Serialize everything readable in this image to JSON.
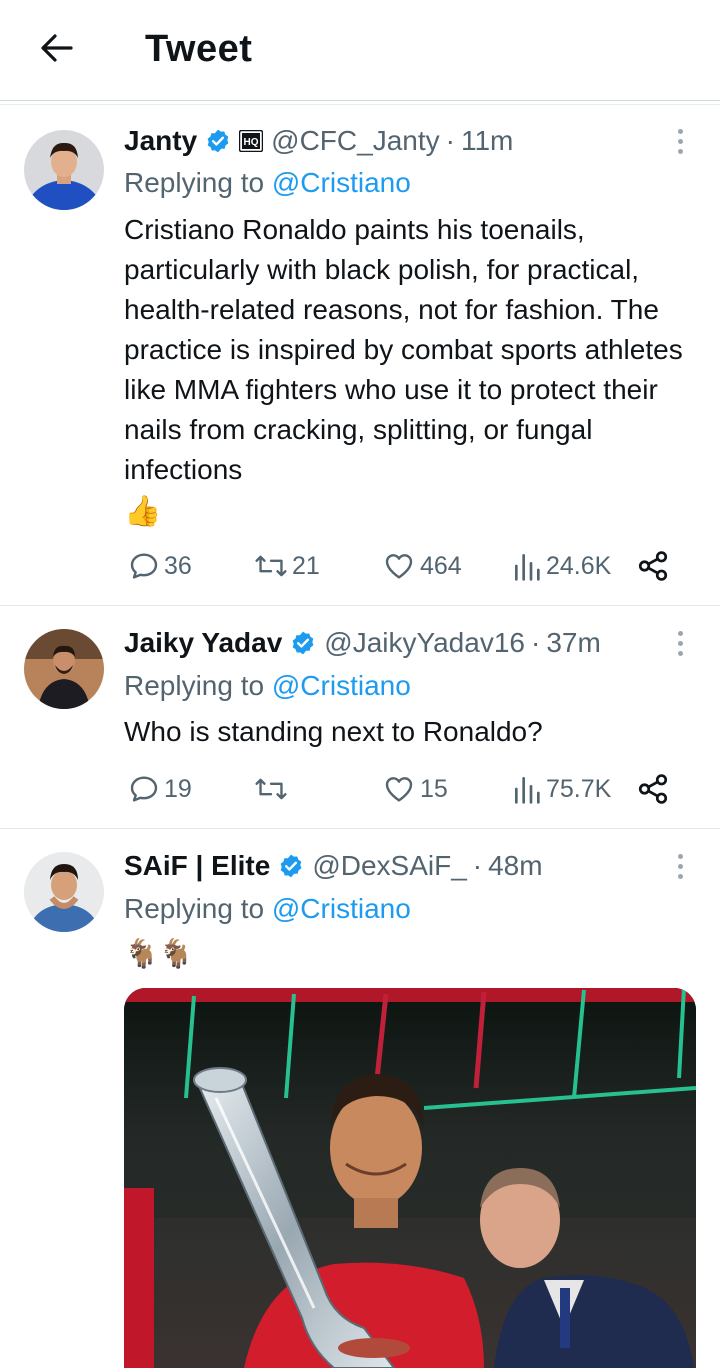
{
  "header": {
    "title": "Tweet"
  },
  "tweets": [
    {
      "author": "Janty",
      "handle": "@CFC_Janty",
      "dot": "·",
      "time": "11m",
      "reply_prefix": "Replying to",
      "reply_to": "@Cristiano",
      "text": "Cristiano Ronaldo paints his toenails, particularly with black polish, for practical, health-related reasons, not for fashion. The practice is inspired by combat sports athletes like MMA fighters who use it to protect their nails from cracking, splitting, or fungal infections",
      "emoji": "👍",
      "replies": "36",
      "retweets": "21",
      "likes": "464",
      "views": "24.6K"
    },
    {
      "author": "Jaiky Yadav",
      "handle": "@JaikyYadav16",
      "dot": "·",
      "time": "37m",
      "reply_prefix": "Replying to",
      "reply_to": "@Cristiano",
      "text": "Who is standing next to Ronaldo?",
      "replies": "19",
      "retweets": "",
      "likes": "15",
      "views": "75.7K"
    },
    {
      "author": "SAiF | Elite",
      "handle": "@DexSAiF_",
      "dot": "·",
      "time": "48m",
      "reply_prefix": "Replying to",
      "reply_to": "@Cristiano",
      "text": "🐐🐐"
    }
  ],
  "colors": {
    "accent": "#1d9bf0",
    "muted": "#536471",
    "text": "#0f1419",
    "divider": "#e1e8ed"
  },
  "icons": [
    "back-arrow-icon",
    "verified-icon",
    "hq-badge-icon",
    "more-icon",
    "reply-icon",
    "retweet-icon",
    "like-icon",
    "views-icon",
    "share-icon"
  ]
}
